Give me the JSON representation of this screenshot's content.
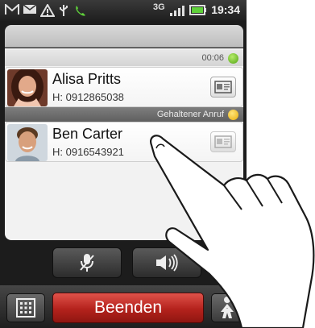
{
  "status_bar": {
    "network": "3G",
    "time": "19:34",
    "icons": [
      "gmail-icon",
      "message-icon",
      "warning-icon",
      "usb-icon",
      "call-active-icon",
      "network-3g-icon",
      "signal-icon",
      "battery-icon"
    ]
  },
  "calls": {
    "active": {
      "timer": "00:06",
      "name": "Alisa Pritts",
      "number": "H: 0912865038",
      "status_color": "#52a414"
    },
    "held": {
      "label": "Gehaltener Anruf",
      "name": "Ben Carter",
      "number": "H: 0916543921",
      "status_color": "#e9ad0b"
    }
  },
  "controls": {
    "mute_icon": "microphone-mute-icon",
    "speaker_icon": "speaker-icon"
  },
  "bottom_bar": {
    "end_label": "Beenden",
    "dialpad_icon": "dialpad-icon",
    "contacts_icon": "person-icon",
    "end_color": "#b4221c"
  }
}
